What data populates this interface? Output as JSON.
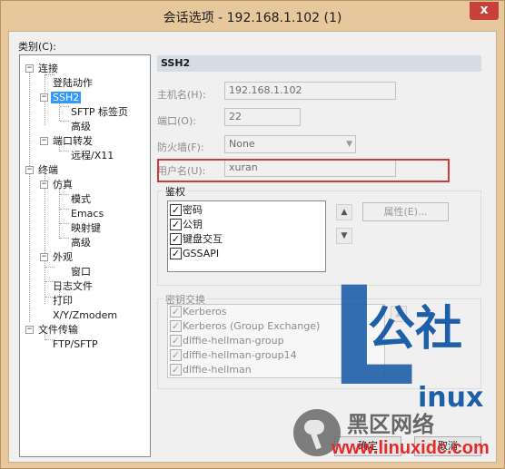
{
  "window": {
    "title": "会话选项 - 192.168.1.102 (1)",
    "close_glyph": "x"
  },
  "category_label": "类别(C):",
  "tree": {
    "expander_open": "−",
    "nodes": [
      {
        "label": "连接"
      },
      {
        "label": "登陆动作"
      },
      {
        "label": "SSH2"
      },
      {
        "label": "SFTP 标签页"
      },
      {
        "label": "高级"
      },
      {
        "label": "端口转发"
      },
      {
        "label": "远程/X11"
      },
      {
        "label": "终端"
      },
      {
        "label": "仿真"
      },
      {
        "label": "模式"
      },
      {
        "label": "Emacs"
      },
      {
        "label": "映射键"
      },
      {
        "label": "高级"
      },
      {
        "label": "外观"
      },
      {
        "label": "窗口"
      },
      {
        "label": "日志文件"
      },
      {
        "label": "打印"
      },
      {
        "label": "X/Y/Zmodem"
      },
      {
        "label": "文件传输"
      },
      {
        "label": "FTP/SFTP"
      }
    ]
  },
  "section_title": "SSH2",
  "form": {
    "hostname_label": "主机名(H):",
    "hostname_value": "192.168.1.102",
    "port_label": "端口(O):",
    "port_value": "22",
    "firewall_label": "防火墙(F):",
    "firewall_value": "None",
    "username_label": "用户名(U):",
    "username_value": "xuran"
  },
  "auth": {
    "title": "鉴权",
    "check_glyph": "✓",
    "items": [
      {
        "label": "密码"
      },
      {
        "label": "公钥"
      },
      {
        "label": "键盘交互"
      },
      {
        "label": "GSSAPI"
      }
    ],
    "properties_button": "属性(E)...",
    "up_arrow": "▲",
    "down_arrow": "▼"
  },
  "key_exchange": {
    "title": "密钥交换",
    "items": [
      {
        "label": "Kerberos"
      },
      {
        "label": "Kerberos (Group Exchange)"
      },
      {
        "label": "diffie-hellman-group"
      },
      {
        "label": "diffie-hellman-group14"
      },
      {
        "label": "diffie-hellman"
      }
    ],
    "up_arrow": "▲"
  },
  "buttons": {
    "ok_label": "确定",
    "cancel_label": "取消"
  },
  "watermark": {
    "brand_cn": "公社",
    "brand_en": "inux",
    "brand_initial": "L",
    "site_cn": "黑区网络",
    "site_url": "www.linuxidc.com",
    "blue": "#1d5fa8",
    "red": "#e32b2b"
  },
  "colors": {
    "title_bar": "#e6c89c",
    "selection": "#3399ff",
    "close_button": "#c7413a",
    "highlight_box": "#d03a3a"
  }
}
